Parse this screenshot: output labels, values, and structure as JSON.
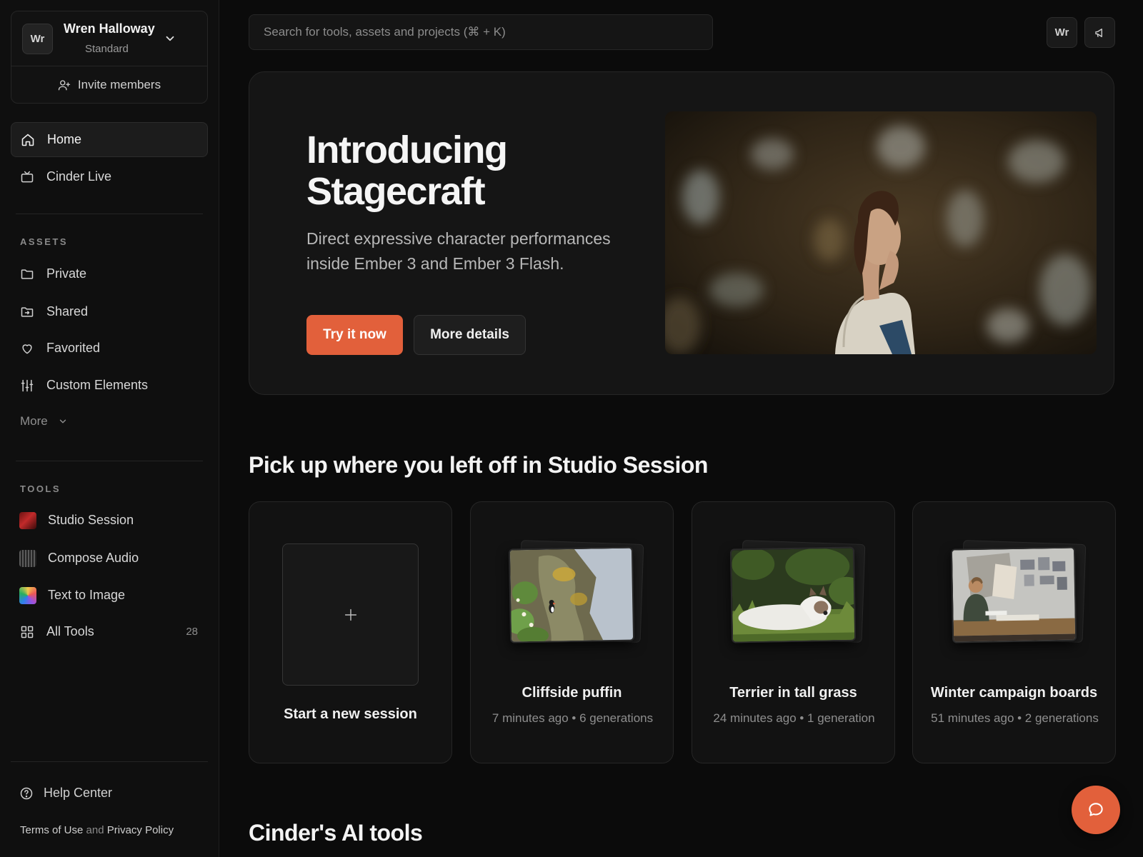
{
  "account": {
    "avatar_initials": "Wr",
    "name": "Wren Halloway",
    "plan": "Standard",
    "invite_label": "Invite members"
  },
  "nav": {
    "home": "Home",
    "live": "Cinder Live"
  },
  "assets": {
    "label": "ASSETS",
    "items": [
      "Private",
      "Shared",
      "Favorited",
      "Custom Elements"
    ],
    "more": "More"
  },
  "tools": {
    "label": "TOOLS",
    "items": [
      "Studio Session",
      "Compose Audio",
      "Text to Image",
      "All Tools"
    ],
    "all_tools_count": "28"
  },
  "footer": {
    "help": "Help Center",
    "terms": "Terms of Use",
    "and": "and",
    "privacy": "Privacy Policy"
  },
  "topbar": {
    "search_placeholder": "Search for tools, assets and projects (⌘ + K)",
    "user_initials": "Wr"
  },
  "hero": {
    "title": "Introducing Stagecraft",
    "subtitle": "Direct expressive character performances inside Ember 3 and Ember 3 Flash.",
    "primary_label": "Try it now",
    "secondary_label": "More details"
  },
  "sessions": {
    "title": "Pick up where you left off in Studio Session",
    "new_label": "Start a new session",
    "cards": [
      {
        "title": "Cliffside puffin",
        "meta": "7 minutes ago • 6 generations"
      },
      {
        "title": "Terrier in tall grass",
        "meta": "24 minutes ago • 1 generation"
      },
      {
        "title": "Winter campaign boards",
        "meta": "51 minutes ago • 2 generations"
      }
    ]
  },
  "tools_section": {
    "title": "Cinder's AI tools"
  },
  "colors": {
    "accent": "#e2603b",
    "background": "#0b0b0b",
    "card": "#121212"
  }
}
